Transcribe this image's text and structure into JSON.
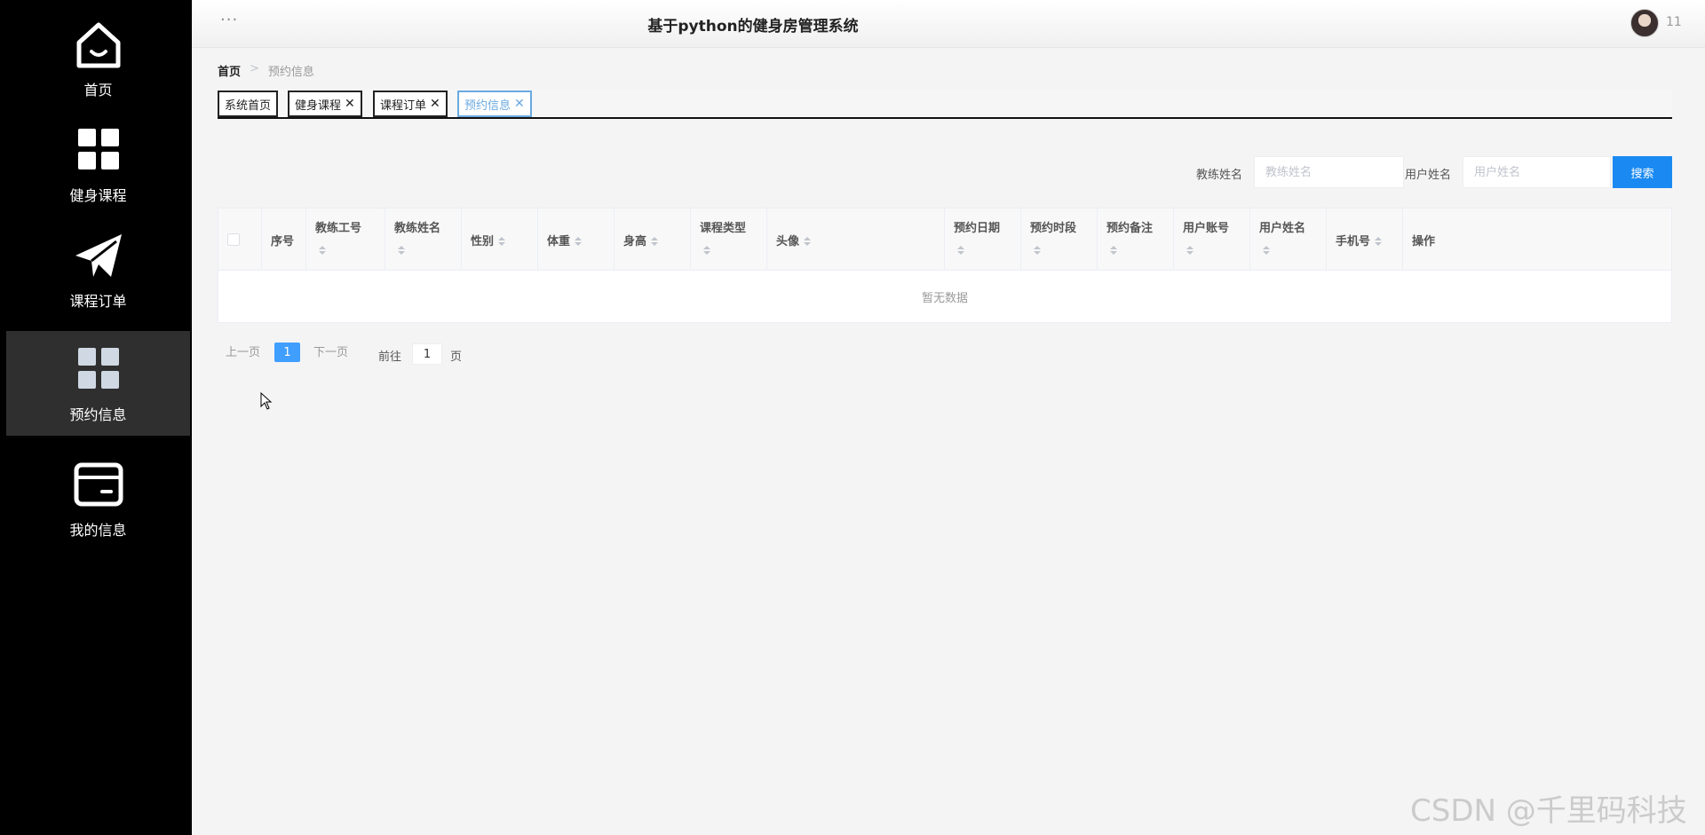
{
  "sidebar": {
    "items": [
      {
        "label": "首页",
        "icon": "home-icon"
      },
      {
        "label": "健身课程",
        "icon": "grid-icon"
      },
      {
        "label": "课程订单",
        "icon": "paper-plane-icon"
      },
      {
        "label": "预约信息",
        "icon": "grid-icon",
        "active": true
      },
      {
        "label": "我的信息",
        "icon": "card-icon"
      }
    ]
  },
  "header": {
    "menu_dots": "···",
    "title": "基于python的健身房管理系统",
    "username": "11"
  },
  "breadcrumb": {
    "home": "首页",
    "separator": ">",
    "current": "预约信息"
  },
  "tabs": [
    {
      "label": "系统首页",
      "closable": false
    },
    {
      "label": "健身课程",
      "closable": true
    },
    {
      "label": "课程订单",
      "closable": true
    },
    {
      "label": "预约信息",
      "closable": true,
      "active": true
    }
  ],
  "tab_close": "✕",
  "search": {
    "coach_name_label": "教练姓名",
    "coach_name_placeholder": "教练姓名",
    "coach_name_value": "",
    "user_name_label": "用户姓名",
    "user_name_placeholder": "用户姓名",
    "user_name_value": "",
    "button": "搜索"
  },
  "table": {
    "columns": [
      "序号",
      "教练工号",
      "教练姓名",
      "性别",
      "体重",
      "身高",
      "课程类型",
      "头像",
      "预约日期",
      "预约时段",
      "预约备注",
      "用户账号",
      "用户姓名",
      "手机号",
      "操作"
    ],
    "rows": [],
    "empty_text": "暂无数据"
  },
  "pagination": {
    "prev": "上一页",
    "current_page": "1",
    "next": "下一页",
    "goto_label": "前往",
    "goto_value": "1",
    "page_unit": "页"
  },
  "watermark": "CSDN @千里码科技",
  "colors": {
    "sidebar_bg": "#000000",
    "active_nav": "#2f2f2f",
    "primary": "#1a8af2",
    "page_active": "#409eff",
    "tab_active": "#6aa9e0"
  }
}
